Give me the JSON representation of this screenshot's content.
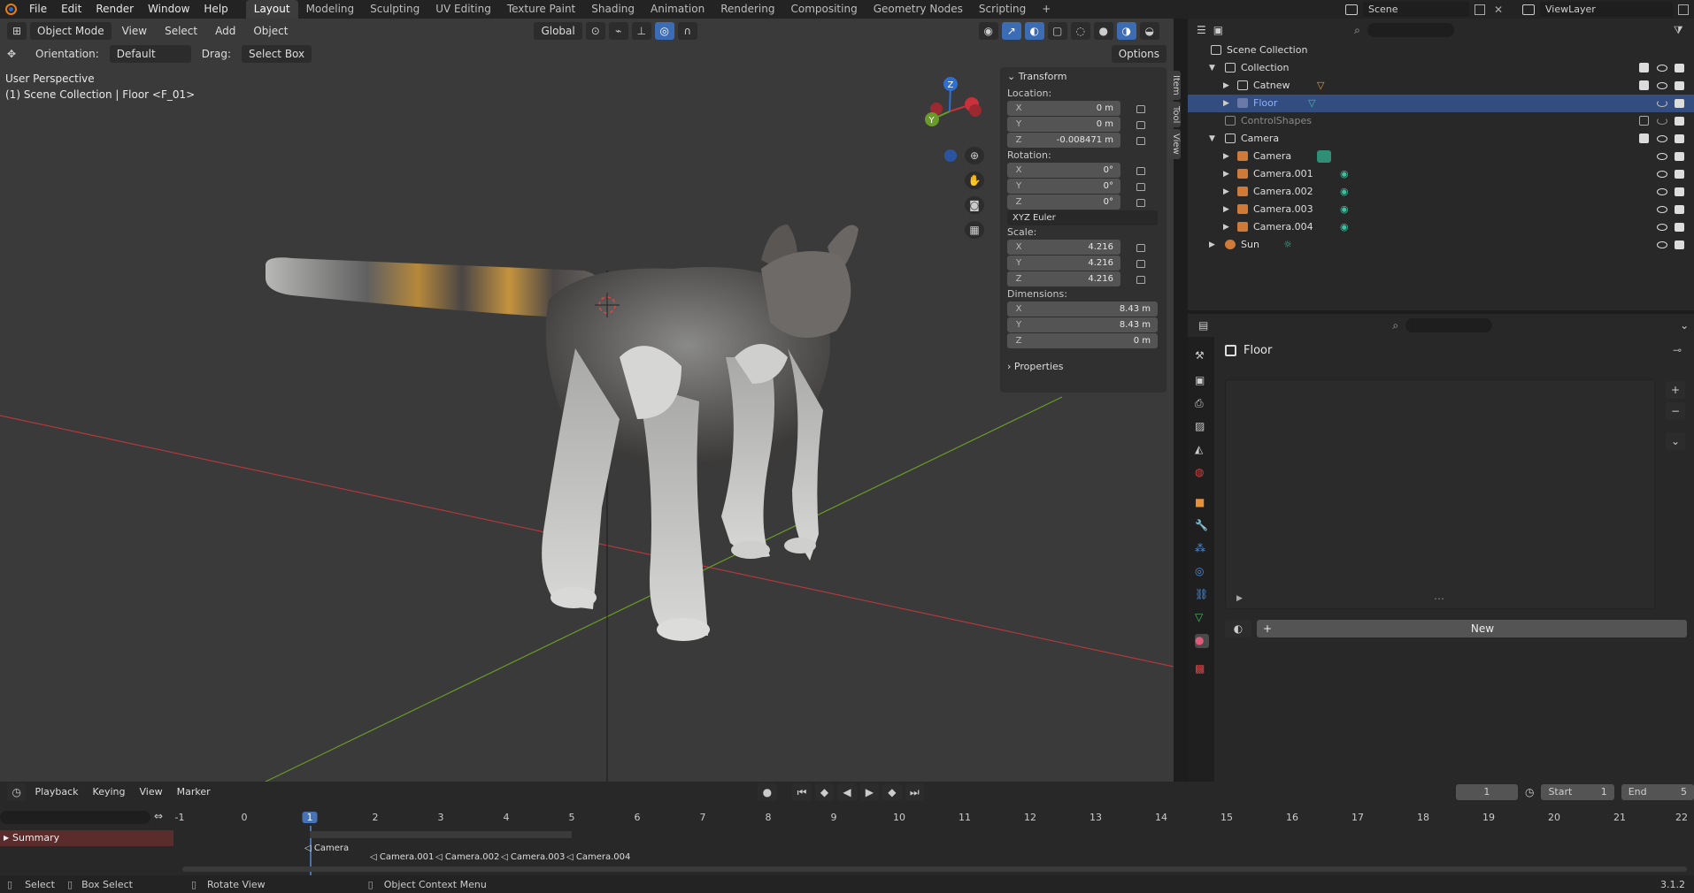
{
  "topbar": {
    "menus": [
      "File",
      "Edit",
      "Render",
      "Window",
      "Help"
    ],
    "workspaces": [
      "Layout",
      "Modeling",
      "Sculpting",
      "UV Editing",
      "Texture Paint",
      "Shading",
      "Animation",
      "Rendering",
      "Compositing",
      "Geometry Nodes",
      "Scripting"
    ],
    "add_workspace": "+",
    "scene_label": "Scene",
    "view_layer_label": "ViewLayer"
  },
  "viewport": {
    "mode": "Object Mode",
    "menus": [
      "View",
      "Select",
      "Add",
      "Object"
    ],
    "transform_orientation": "Global",
    "orientation_label": "Orientation:",
    "orientation_value": "Default",
    "drag_label": "Drag:",
    "drag_value": "Select Box",
    "options_label": "Options",
    "perspective_text": "User Perspective",
    "context_text": "(1) Scene Collection | Floor <F_01>",
    "gizmo": {
      "x": "X",
      "y": "Y",
      "z": "Z"
    }
  },
  "npanel": {
    "tabs": [
      "Item",
      "Tool",
      "View"
    ],
    "transform_title": "Transform",
    "location_label": "Location:",
    "location": [
      {
        "axis": "X",
        "value": "0 m"
      },
      {
        "axis": "Y",
        "value": "0 m"
      },
      {
        "axis": "Z",
        "value": "-0.008471 m"
      }
    ],
    "rotation_label": "Rotation:",
    "rotation": [
      {
        "axis": "X",
        "value": "0°"
      },
      {
        "axis": "Y",
        "value": "0°"
      },
      {
        "axis": "Z",
        "value": "0°"
      }
    ],
    "rotation_mode": "XYZ Euler",
    "scale_label": "Scale:",
    "scale": [
      {
        "axis": "X",
        "value": "4.216"
      },
      {
        "axis": "Y",
        "value": "4.216"
      },
      {
        "axis": "Z",
        "value": "4.216"
      }
    ],
    "dimensions_label": "Dimensions:",
    "dimensions": [
      {
        "axis": "X",
        "value": "8.43 m"
      },
      {
        "axis": "Y",
        "value": "8.43 m"
      },
      {
        "axis": "Z",
        "value": "0 m"
      }
    ],
    "properties_title": "Properties"
  },
  "outliner": {
    "rows": [
      {
        "label": "Scene Collection",
        "indent": 0
      },
      {
        "label": "Collection",
        "indent": 1
      },
      {
        "label": "Catnew",
        "indent": 2
      },
      {
        "label": "Floor",
        "indent": 2,
        "selected": true
      },
      {
        "label": "ControlShapes",
        "indent": 1
      },
      {
        "label": "Camera",
        "indent": 1
      },
      {
        "label": "Camera",
        "indent": 2
      },
      {
        "label": "Camera.001",
        "indent": 2
      },
      {
        "label": "Camera.002",
        "indent": 2
      },
      {
        "label": "Camera.003",
        "indent": 2
      },
      {
        "label": "Camera.004",
        "indent": 2
      },
      {
        "label": "Sun",
        "indent": 1
      }
    ]
  },
  "properties": {
    "object_name": "Floor",
    "new_button": "New"
  },
  "timeline": {
    "menus": [
      "Playback",
      "Keying",
      "View",
      "Marker"
    ],
    "current_frame": "1",
    "start_label": "Start",
    "start_value": "1",
    "end_label": "End",
    "end_value": "5",
    "ticks": [
      "-1",
      "0",
      "1",
      "2",
      "3",
      "4",
      "5",
      "6",
      "7",
      "8",
      "9",
      "10",
      "11",
      "12",
      "13",
      "14",
      "15",
      "16",
      "17",
      "18",
      "19",
      "20",
      "21",
      "22"
    ],
    "summary_label": "Summary",
    "markers": [
      "Camera",
      "Camera.001",
      "Camera.002",
      "Camera.003",
      "Camera.004"
    ]
  },
  "statusbar": {
    "select": "Select",
    "box_select": "Box Select",
    "rotate_view": "Rotate View",
    "context_menu": "Object Context Menu",
    "version": "3.1.2"
  },
  "colors": {
    "accent": "#4772b3",
    "selection": "#334d80",
    "x_axis": "#c8303c",
    "y_axis": "#6a9a28",
    "z_axis": "#2e6fd0"
  }
}
